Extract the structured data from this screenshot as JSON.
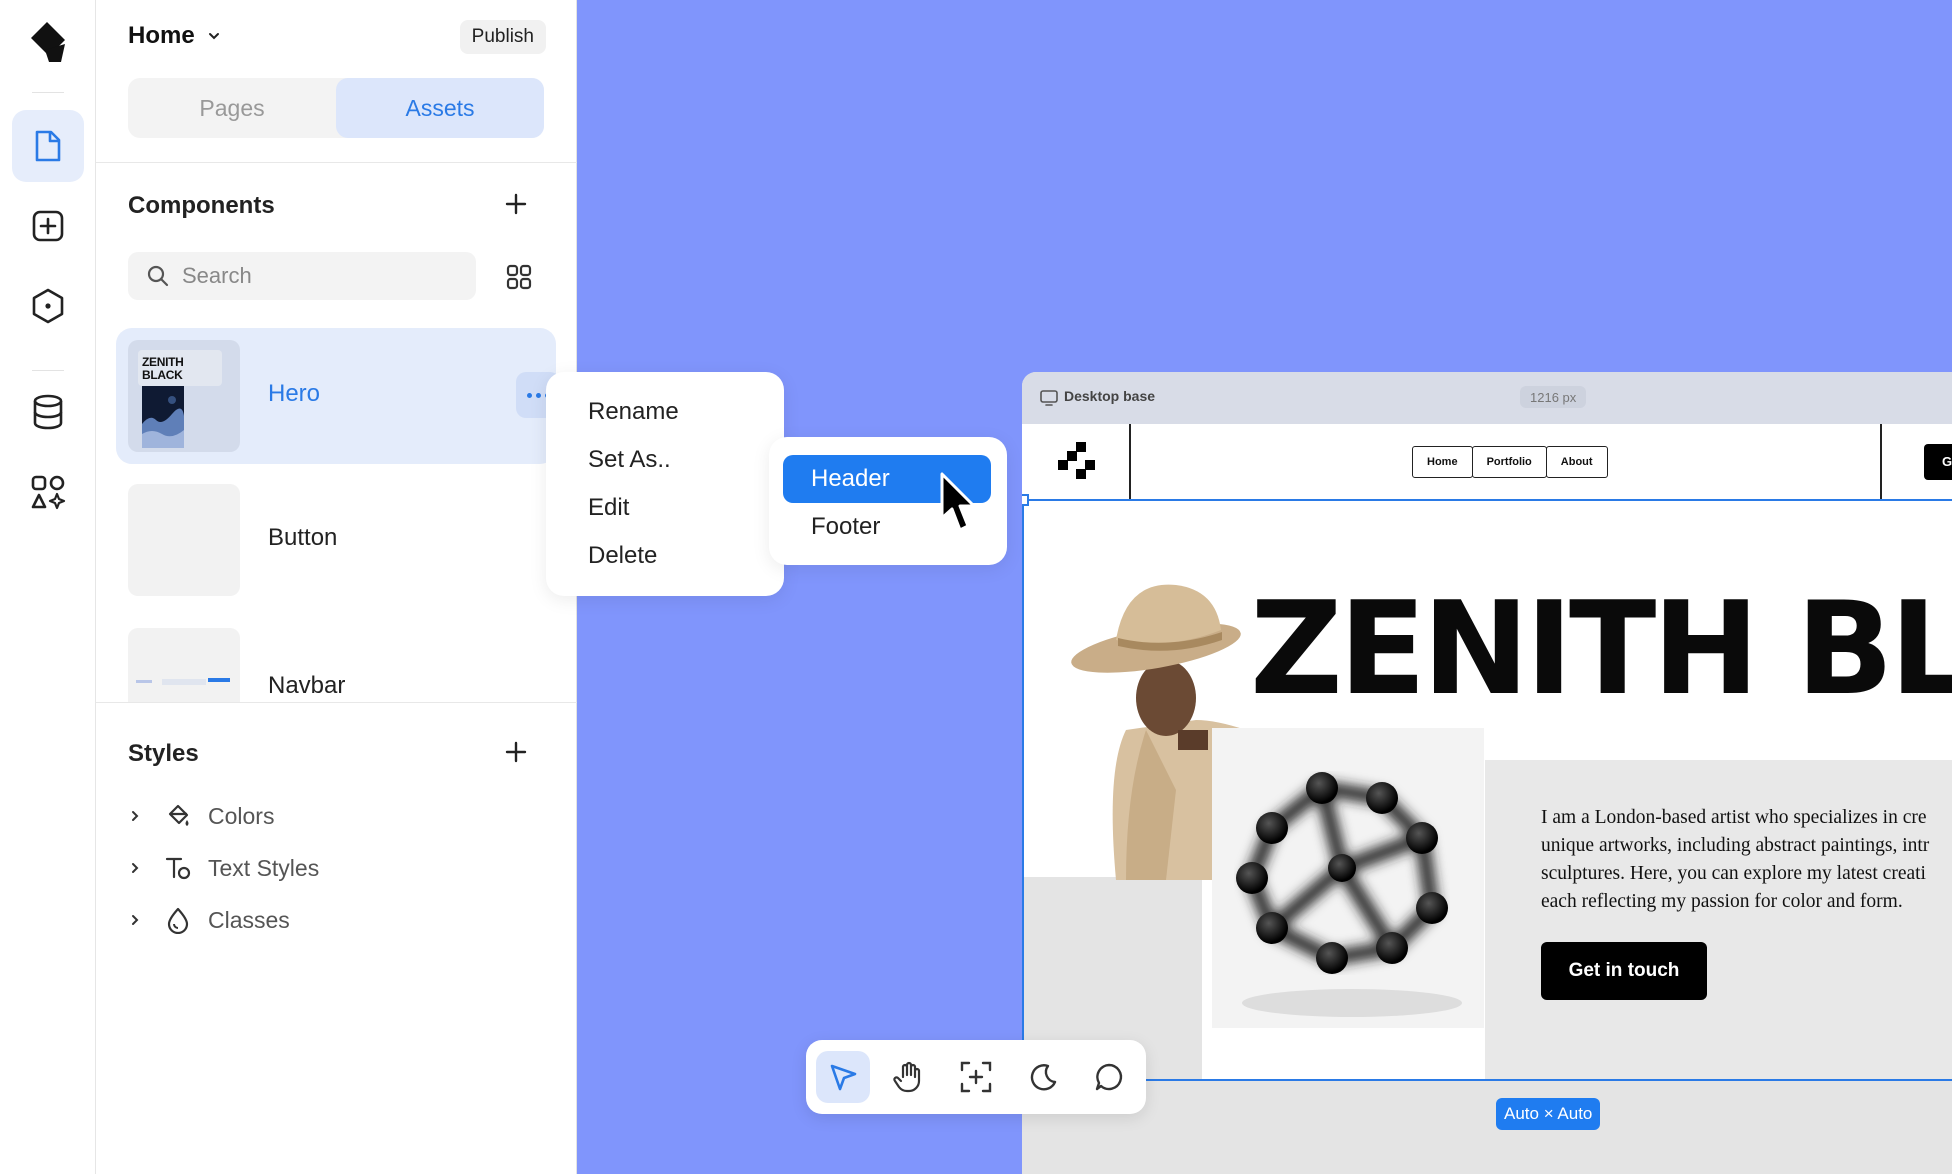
{
  "header": {
    "page_title": "Home",
    "publish_label": "Publish"
  },
  "tabs": [
    {
      "label": "Pages"
    },
    {
      "label": "Assets"
    }
  ],
  "components": {
    "title": "Components",
    "search_placeholder": "Search",
    "items": [
      {
        "name": "Hero",
        "thumb_text": "ZENITH BLACK"
      },
      {
        "name": "Button"
      },
      {
        "name": "Navbar"
      }
    ]
  },
  "styles": {
    "title": "Styles",
    "items": [
      {
        "label": "Colors"
      },
      {
        "label": "Text Styles"
      },
      {
        "label": "Classes"
      }
    ]
  },
  "context_menu": {
    "items": [
      {
        "label": "Rename"
      },
      {
        "label": "Set As.."
      },
      {
        "label": "Edit"
      },
      {
        "label": "Delete"
      }
    ]
  },
  "submenu": {
    "items": [
      {
        "label": "Header"
      },
      {
        "label": "Footer"
      }
    ]
  },
  "preview": {
    "frame_label": "Desktop base",
    "frame_width": "1216 px",
    "nav_links": [
      {
        "label": "Home"
      },
      {
        "label": "Portfolio"
      },
      {
        "label": "About"
      }
    ],
    "nav_cta_clipped": "G",
    "hero_title": "ZENITH BLAC",
    "hero_text_lines": [
      "I am a London-based artist who specializes in cre",
      "unique artworks, including abstract paintings, intr",
      "sculptures. Here, you can explore my latest creati",
      "each reflecting my passion for color and form."
    ],
    "hero_button": "Get in touch",
    "size_badge": "Auto × Auto"
  },
  "colors": {
    "canvas_bg": "#8095fc",
    "accent": "#1f7cf0",
    "selected_bg": "#e4ecfb"
  },
  "icons": {
    "rail": [
      "logo-icon",
      "page-icon",
      "add-square-icon",
      "hexagon-icon",
      "database-icon",
      "apps-icon"
    ],
    "toolbar": [
      "pointer-icon",
      "hand-icon",
      "frame-add-icon",
      "moon-icon",
      "comment-icon"
    ]
  }
}
